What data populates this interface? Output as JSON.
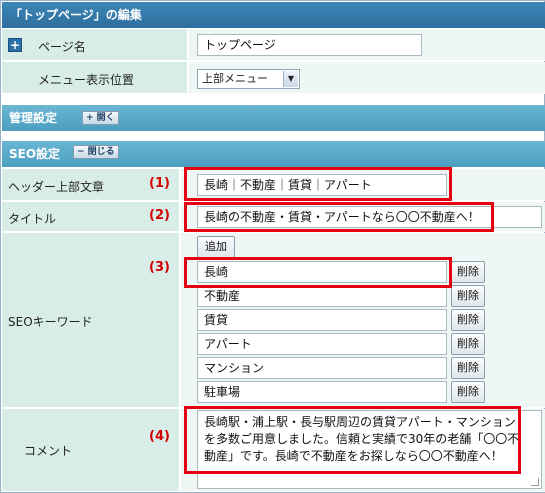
{
  "page_title": "「トップページ」の編集",
  "rows": {
    "page_name": {
      "label": "ページ名",
      "value": "トップページ",
      "icon": "plus-icon"
    },
    "menu_position": {
      "label": "メニュー表示位置",
      "selected": "上部メニュー"
    }
  },
  "sections": {
    "admin": {
      "title": "管理設定",
      "toggle_label": "+ 開く"
    },
    "seo": {
      "title": "SEO設定",
      "toggle_label": "− 閉じる"
    }
  },
  "seo_fields": {
    "header_text": {
      "label": "ヘッダー上部文章",
      "value": "長崎｜不動産｜賃貸｜アパート",
      "annotation": "(1)"
    },
    "title": {
      "label": "タイトル",
      "value": "長崎の不動産・賃貸・アパートなら〇〇不動産へ！",
      "annotation": "(2)"
    },
    "keywords": {
      "label": "SEOキーワード",
      "add_button": "追加",
      "delete_button": "削除",
      "annotation": "(3)",
      "items": [
        "長崎",
        "不動産",
        "賃貸",
        "アパート",
        "マンション",
        "駐車場"
      ]
    },
    "comment": {
      "label": "コメント",
      "annotation": "(4)",
      "lines": [
        "長崎駅・浦上駅・長与駅周辺の賃貸アパート・マンション",
        "を多数ご用意しました。信頼と実績で30年の老舗「〇〇不",
        "動産」です。長崎で不動産をお探しなら〇〇不動産へ！"
      ]
    }
  },
  "colors": {
    "title_bar": "#2d6f9e",
    "section_bar": "#4b9ec0",
    "label_bg": "#d8ede7",
    "annotation": "#e60012"
  }
}
